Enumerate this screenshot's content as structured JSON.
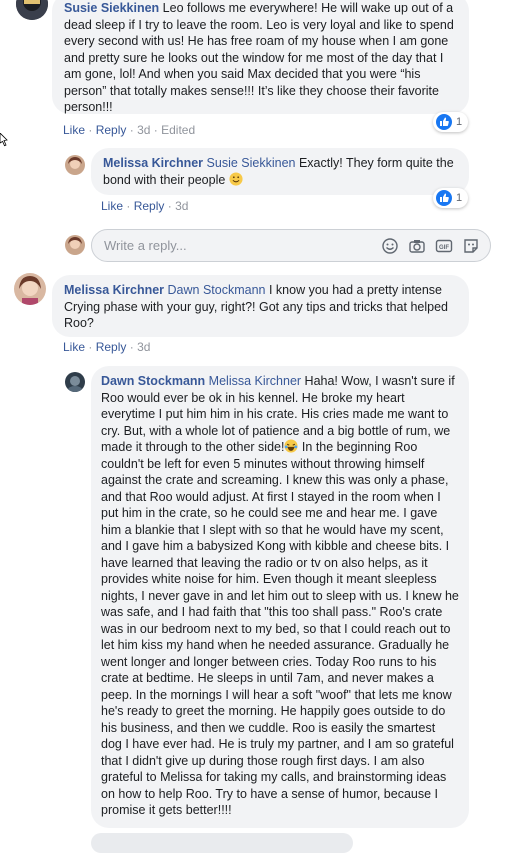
{
  "comments": [
    {
      "author": "Susie Siekkinen",
      "text": "Leo follows me everywhere! He will wake up out of a dead sleep if I try to leave the room. Leo is very loyal and like to spend every second with us! He has free roam of my house when I am gone and pretty sure he looks out the window for me most of the day that I am gone, lol! And when you said Max decided that you were “his person” that totally makes sense!!! It’s like they choose their favorite person!!!",
      "like": "Like",
      "reply": "Reply",
      "time": "3d",
      "edited": "Edited",
      "reactions": "1"
    },
    {
      "author": "Melissa Kirchner",
      "mention": "Susie Siekkinen",
      "text": "Exactly! They form quite the bond with their people",
      "like": "Like",
      "reply": "Reply",
      "time": "3d",
      "reactions": "1"
    },
    {
      "author": "Melissa Kirchner",
      "mention": "Dawn Stockmann",
      "text": "I know you had a pretty intense Crying phase with your guy, right?! Got any tips and tricks that helped Roo?",
      "like": "Like",
      "reply": "Reply",
      "time": "3d"
    },
    {
      "author": "Dawn Stockmann",
      "mention": "Melissa Kirchner",
      "text_part1": "Haha! Wow, I wasn't sure if Roo would ever be ok in his kennel. He broke my heart everytime I put him him in his crate. His cries made me want to cry. But, with a whole lot of patience and a big bottle of rum, we made it through to the other side!",
      "text_part2": " In the beginning Roo couldn't be left for even 5 minutes without throwing himself against the crate and screaming. I knew this was only a phase, and that Roo would adjust. At first I stayed in the room when I put him in the crate, so he could see me and hear me. I gave him a blankie that I slept with so that he would have my scent, and I gave him a babysized Kong with kibble and cheese bits. I have learned that leaving the radio or tv on also helps, as it provides white noise for him. Even though it meant sleepless nights, I never gave in and let him out to sleep with us. I knew he was safe, and I had faith that \"this too shall pass.\" Roo's crate was in our bedroom next to my bed, so that I could reach out to let him kiss my hand when he needed assurance. Gradually he went longer and longer between cries. Today Roo runs to his crate at bedtime. He sleeps in until 7am, and never makes a peep. In the mornings I will hear a soft \"woof\" that lets me know he's ready to greet the morning. He happily goes outside to do his business, and then we cuddle. Roo is easily the smartest dog I have ever had. He is truly my partner, and I am so grateful that I didn't give up during those rough first days. I am also grateful to Melissa for taking my calls, and brainstorming ideas on how to help Roo. Try to have a sense of humor, because I promise it gets better!!!!"
    }
  ],
  "reply_box": {
    "placeholder": "Write a reply..."
  },
  "colors": {
    "link": "#385898",
    "bubble": "#f2f3f5",
    "meta": "#90949c",
    "like_blue": "#1877f2"
  }
}
